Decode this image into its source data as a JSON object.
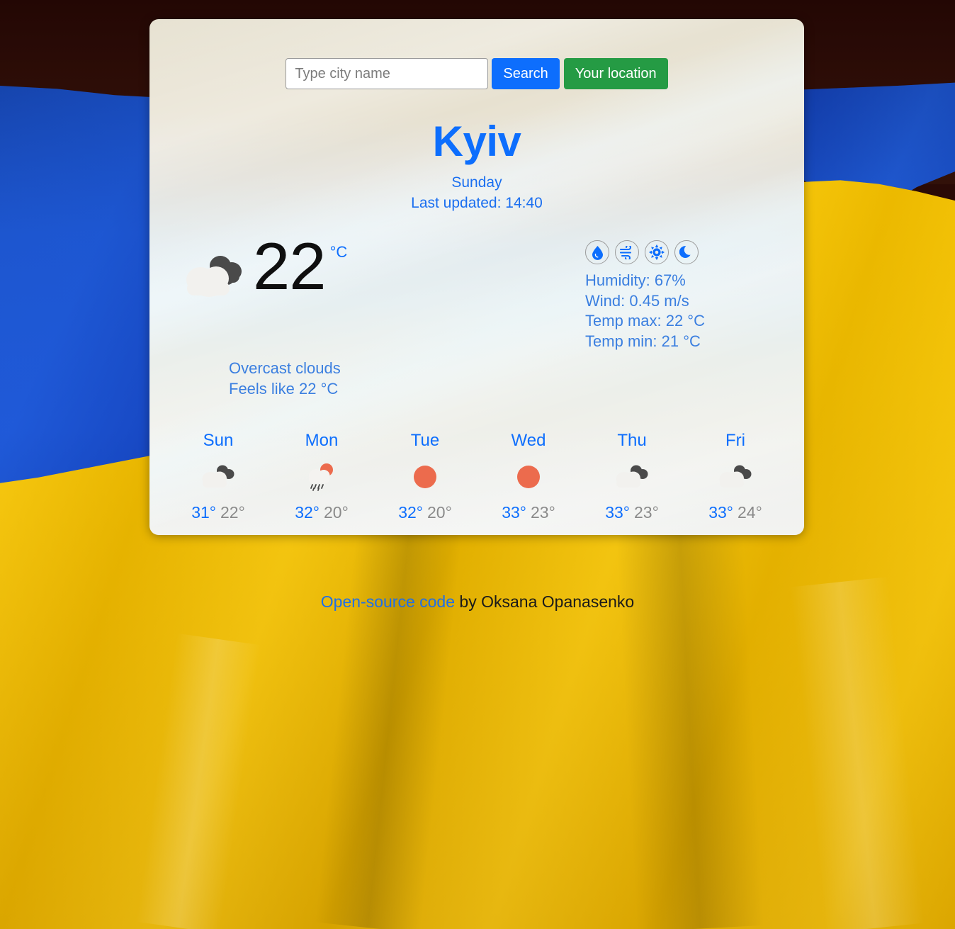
{
  "search": {
    "placeholder": "Type city name",
    "value": "",
    "search_label": "Search",
    "location_label": "Your location"
  },
  "current": {
    "city": "Kyiv",
    "weekday": "Sunday",
    "last_updated": "Last updated: 14:40",
    "temperature": "22",
    "unit": "°C",
    "condition": "Overcast clouds",
    "feels_like": "Feels like 22 °C",
    "icon": "overcast-clouds-icon",
    "details": [
      {
        "icon": "humidity-droplet-icon",
        "label": "Humidity: 67%"
      },
      {
        "icon": "wind-icon",
        "label": "Wind: 0.45 m/s"
      },
      {
        "icon": "sun-icon",
        "label": "Temp max: 22 °C"
      },
      {
        "icon": "moon-icon",
        "label": "Temp min: 21 °C"
      }
    ]
  },
  "forecast": [
    {
      "day": "Sun",
      "icon": "overcast-clouds-icon",
      "max": "31°",
      "min": "22°"
    },
    {
      "day": "Mon",
      "icon": "sun-rain-cloud-icon",
      "max": "32°",
      "min": "20°"
    },
    {
      "day": "Tue",
      "icon": "clear-sun-icon",
      "max": "32°",
      "min": "20°"
    },
    {
      "day": "Wed",
      "icon": "clear-sun-icon",
      "max": "33°",
      "min": "23°"
    },
    {
      "day": "Thu",
      "icon": "overcast-clouds-icon",
      "max": "33°",
      "min": "23°"
    },
    {
      "day": "Fri",
      "icon": "overcast-clouds-icon",
      "max": "33°",
      "min": "24°"
    }
  ],
  "footer": {
    "link_text": "Open-source code",
    "rest_text": " by Oksana Opanasenko"
  },
  "colors": {
    "accent_blue": "#0d6efd",
    "search_button": "#0d6efd",
    "location_button": "#259b44",
    "sun_orange": "#ec6b4d",
    "min_temp_gray": "#8a8a8a",
    "flag_blue": "#1d55cc",
    "flag_yellow": "#f5c300",
    "card_bg": "#e7e2d2"
  }
}
